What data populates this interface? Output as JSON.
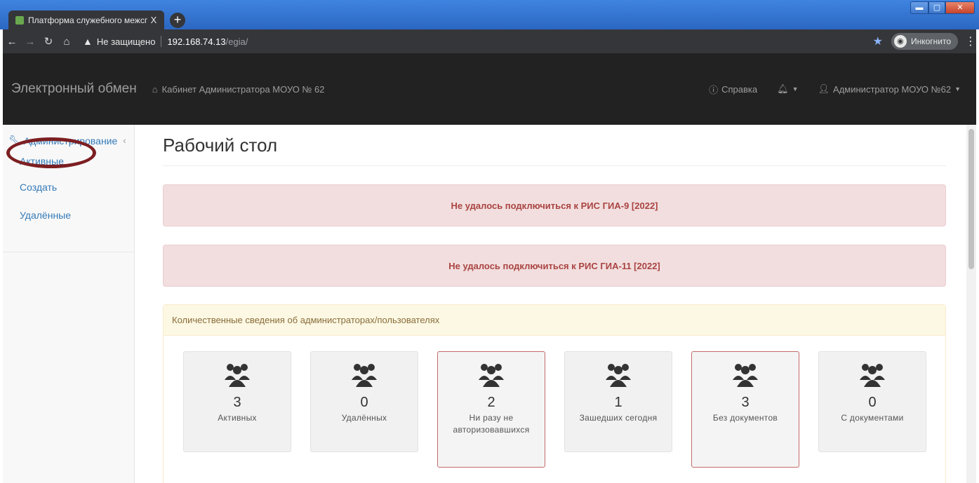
{
  "browser": {
    "tab_title": "Платформа служебного межсгр",
    "tab_close": "X",
    "new_tab": "+",
    "security_label": "Не защищено",
    "url_host": "192.168.74.13",
    "url_path": "/egia/",
    "incognito_label": "Инкогнито"
  },
  "navbar": {
    "brand": "Электронный обмен",
    "breadcrumb": "Кабинет Администратора МОУО № 62",
    "help": "Справка",
    "user": "Администратор МОУО №62"
  },
  "sidebar": {
    "section": "Администрирование",
    "items": [
      {
        "label": "Активные"
      },
      {
        "label": "Создать"
      },
      {
        "label": "Удалённые"
      }
    ]
  },
  "main": {
    "title": "Рабочий стол",
    "alerts": [
      "Не удалось подключиться к РИС ГИА-9 [2022]",
      "Не удалось подключиться к РИС ГИА-11 [2022]"
    ],
    "panel": {
      "heading": "Количественные сведения об администраторах/пользователях",
      "stats": [
        {
          "value": "3",
          "label": "Активных",
          "warning": false
        },
        {
          "value": "0",
          "label": "Удалённых",
          "warning": false
        },
        {
          "value": "2",
          "label": "Ни разу не авторизовавшихся",
          "warning": true
        },
        {
          "value": "1",
          "label": "Зашедших сегодня",
          "warning": false
        },
        {
          "value": "3",
          "label": "Без документов",
          "warning": true
        },
        {
          "value": "0",
          "label": "С документами",
          "warning": false
        }
      ]
    }
  },
  "colors": {
    "navbar_bg": "#222222",
    "link": "#337ab7",
    "alert_bg": "#f2dede",
    "alert_text": "#a94442",
    "panel_head_bg": "#fcf8e3",
    "highlight": "#7c1f22"
  }
}
